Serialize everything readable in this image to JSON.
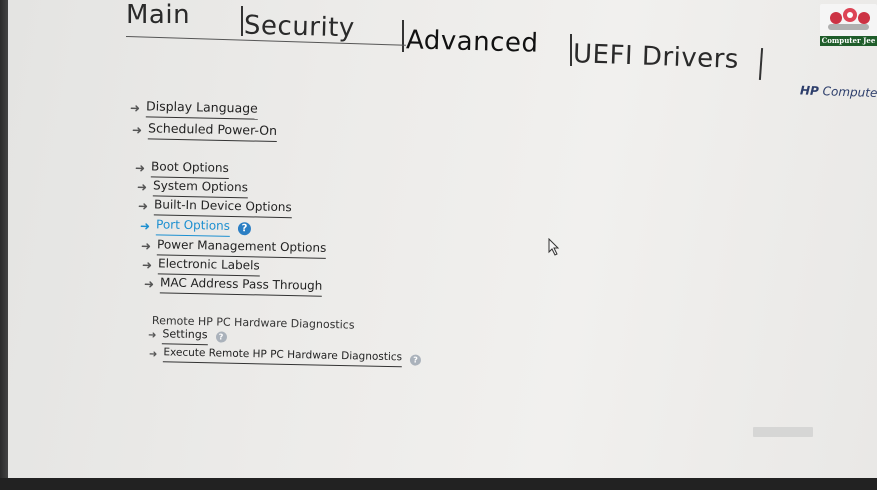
{
  "tabs": {
    "main": "Main",
    "security": "Security",
    "advanced": "Advanced",
    "uefi": "UEFI Drivers"
  },
  "brand": {
    "bold": "HP",
    "rest": " Computer S"
  },
  "logo": {
    "caption": "Computer Jee"
  },
  "menu": {
    "display_language": "Display Language",
    "scheduled_power_on": "Scheduled Power-On",
    "boot_options": "Boot Options",
    "system_options": "System Options",
    "builtin_device_options": "Built-In Device Options",
    "port_options": "Port Options",
    "power_management_options": "Power Management Options",
    "electronic_labels": "Electronic Labels",
    "mac_address_pass_through": "MAC Address Pass Through"
  },
  "remote": {
    "title": "Remote HP PC Hardware Diagnostics",
    "settings": "Settings",
    "execute": "Execute Remote HP PC Hardware Diagnostics"
  },
  "icons": {
    "arrow": "arrow-right-icon",
    "help": "help-icon",
    "cursor": "mouse-pointer-icon"
  },
  "colors": {
    "selected": "#1c8fd0",
    "help_badge": "#2b7fc4"
  }
}
